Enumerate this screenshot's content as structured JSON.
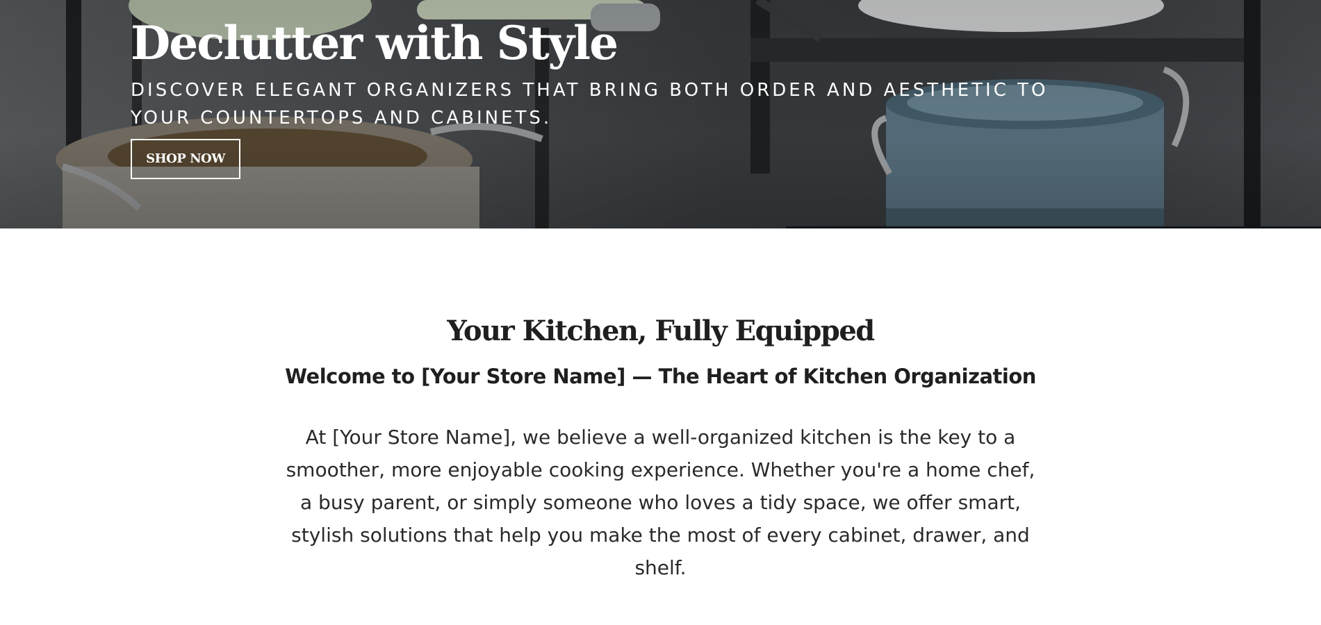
{
  "hero": {
    "title": "Declutter with Style",
    "subtitle": "Discover elegant organizers that bring both order and aesthetic to your countertops and cabinets.",
    "button_label": "SHOP NOW"
  },
  "intro": {
    "title": "Your Kitchen, Fully Equipped",
    "subtitle": "Welcome to [Your Store Name] — The Heart of Kitchen Organization",
    "body": "At [Your Store Name], we believe a well-organized kitchen is the key to a smoother, more enjoyable cooking experience. Whether you're a home chef, a busy parent, or simply someone who loves a tidy space, we offer smart, stylish solutions that help you make the most of every cabinet, drawer, and shelf."
  },
  "colors": {
    "text_dark": "#1f1f1f",
    "hero_text": "#ffffff",
    "background": "#ffffff"
  }
}
